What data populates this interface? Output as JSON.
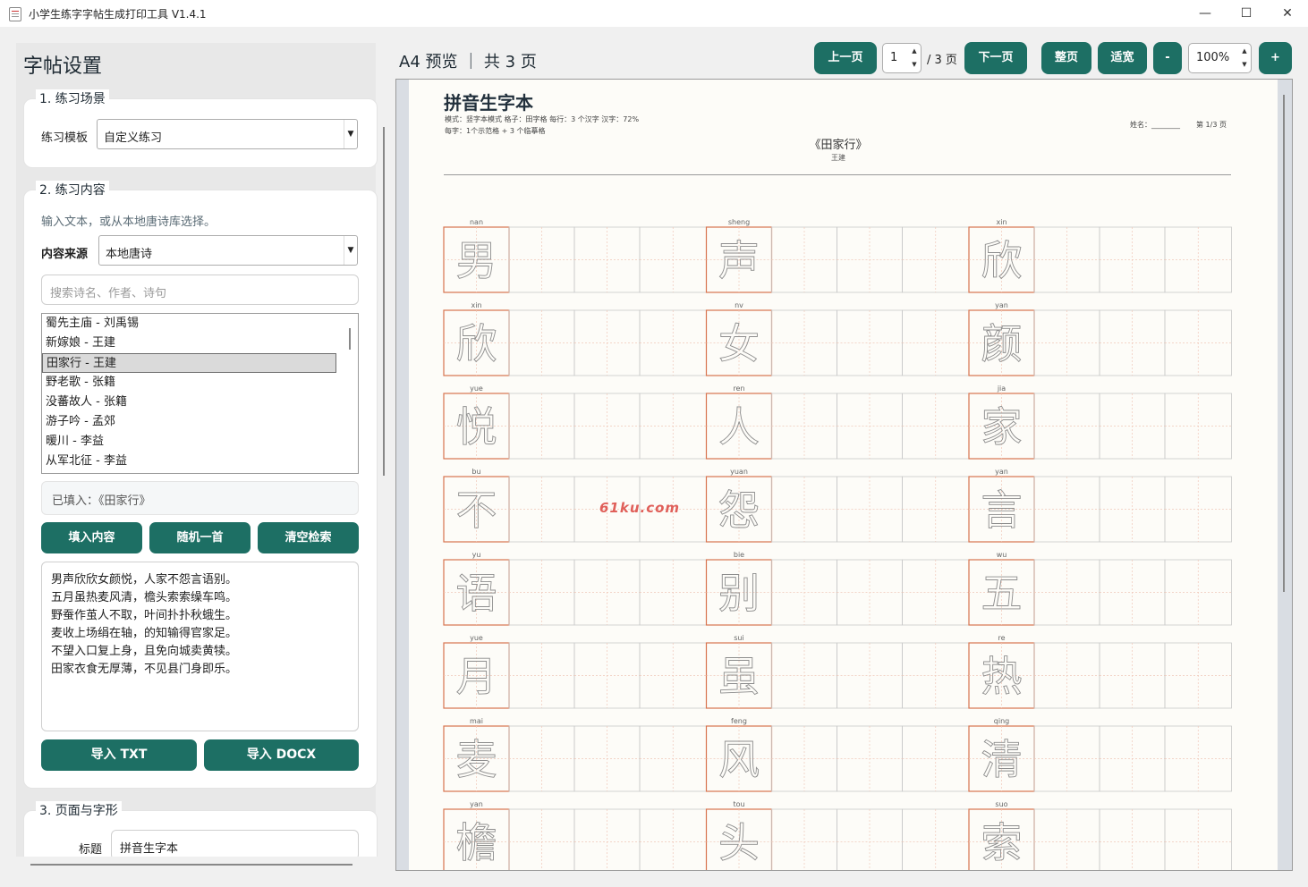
{
  "window": {
    "title": "小学生练字字帖生成打印工具 V1.4.1",
    "controls": [
      "—",
      "☐",
      "✕"
    ]
  },
  "sidebar": {
    "heading": "字帖设置",
    "section1": {
      "label": "1. 练习场景",
      "template_label": "练习模板",
      "template_value": "自定义练习"
    },
    "section2": {
      "label": "2. 练习内容",
      "hint": "输入文本，或从本地唐诗库选择。",
      "source_label": "内容来源",
      "source_value": "本地唐诗",
      "search_placeholder": "搜索诗名、作者、诗句",
      "poems": [
        "蜀先主庙 - 刘禹锡",
        "新嫁娘 - 王建",
        "田家行 - 王建",
        "野老歌 - 张籍",
        "没蕃故人 - 张籍",
        "游子吟 - 孟郊",
        "暖川 - 李益",
        "从军北征 - 李益"
      ],
      "selected_index": 2,
      "filled_text": "已填入：《田家行》",
      "btn_fill": "填入内容",
      "btn_random": "随机一首",
      "btn_clear": "清空检索",
      "content_lines": [
        "男声欣欣女颜悦，人家不怨言语别。",
        "五月虽热麦风清，檐头索索缲车鸣。",
        "野蚕作茧人不取，叶间扑扑秋蛾生。",
        "麦收上场绢在轴，的知输得官家足。",
        "不望入口复上身，且免向城卖黄犊。",
        "田家衣食无厚薄，不见县门身即乐。"
      ],
      "btn_txt": "导入 TXT",
      "btn_docx": "导入 DOCX"
    },
    "section3": {
      "label": "3. 页面与字形",
      "title_label": "标题",
      "title_value": "拼音生字本"
    }
  },
  "toolbar": {
    "preview_title": "A4 预览 ｜ 共 3 页",
    "prev": "上一页",
    "page_value": "1",
    "page_total": "/ 3 页",
    "next": "下一页",
    "fit_page": "整页",
    "fit_width": "适宽",
    "zoom_out": "-",
    "zoom_value": "100%",
    "zoom_in": "+"
  },
  "document": {
    "title": "拼音生字本",
    "meta_line1": "模式：竖字本模式    格子：田字格    每行：3 个汉字    汉字：72%",
    "meta_line2": "每字：1个示范格 + 3 个临摹格",
    "name_label": "姓名：________",
    "page_label": "第 1/3 页",
    "poem_title": "《田家行》",
    "poem_author": "王建",
    "watermark": "61ku.com",
    "rows": [
      [
        {
          "py": "nan",
          "ch": "男"
        },
        {
          "py": "sheng",
          "ch": "声"
        },
        {
          "py": "xin",
          "ch": "欣"
        }
      ],
      [
        {
          "py": "xin",
          "ch": "欣"
        },
        {
          "py": "nv",
          "ch": "女"
        },
        {
          "py": "yan",
          "ch": "颜"
        }
      ],
      [
        {
          "py": "yue",
          "ch": "悦"
        },
        {
          "py": "ren",
          "ch": "人"
        },
        {
          "py": "jia",
          "ch": "家"
        }
      ],
      [
        {
          "py": "bu",
          "ch": "不"
        },
        {
          "py": "yuan",
          "ch": "怨"
        },
        {
          "py": "yan",
          "ch": "言"
        }
      ],
      [
        {
          "py": "yu",
          "ch": "语"
        },
        {
          "py": "bie",
          "ch": "别"
        },
        {
          "py": "wu",
          "ch": "五"
        }
      ],
      [
        {
          "py": "yue",
          "ch": "月"
        },
        {
          "py": "sui",
          "ch": "虽"
        },
        {
          "py": "re",
          "ch": "热"
        }
      ],
      [
        {
          "py": "mai",
          "ch": "麦"
        },
        {
          "py": "feng",
          "ch": "风"
        },
        {
          "py": "qing",
          "ch": "清"
        }
      ],
      [
        {
          "py": "yan",
          "ch": "檐"
        },
        {
          "py": "tou",
          "ch": "头"
        },
        {
          "py": "suo",
          "ch": "索"
        }
      ]
    ]
  }
}
